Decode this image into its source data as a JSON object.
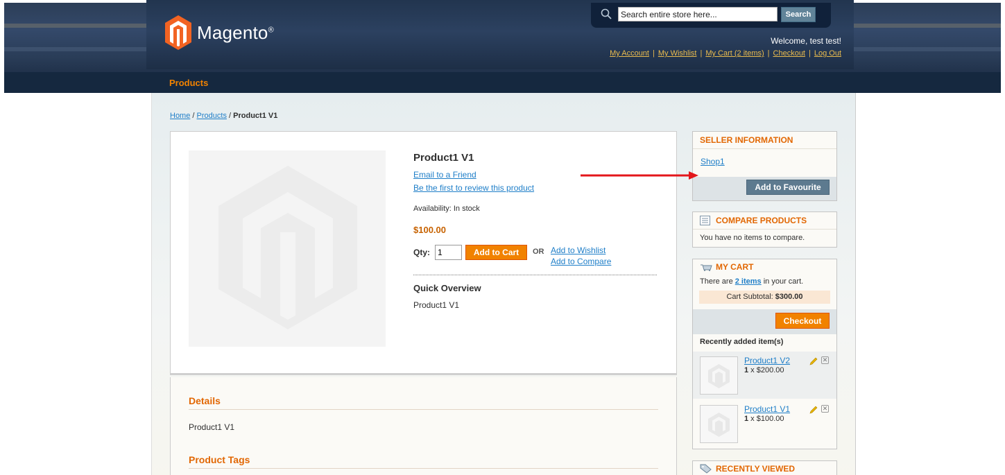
{
  "header": {
    "brand": "Magento",
    "brand_mark": "®",
    "search_placeholder": "Search entire store here...",
    "search_button": "Search",
    "welcome": "Welcome, test test!",
    "links": [
      "My Account",
      "My Wishlist",
      "My Cart (2 items)",
      "Checkout",
      "Log Out"
    ]
  },
  "nav": {
    "products": "Products"
  },
  "breadcrumb": {
    "home": "Home",
    "products": "Products",
    "current": "Product1 V1",
    "sep": "/"
  },
  "product": {
    "name": "Product1 V1",
    "email_friend": "Email to a Friend",
    "review": "Be the first to review this product",
    "availability": "Availability: In stock",
    "price": "$100.00",
    "qty_label": "Qty:",
    "qty_value": "1",
    "add_to_cart": "Add to Cart",
    "or": "OR",
    "add_wishlist": "Add to Wishlist",
    "add_compare": "Add to Compare",
    "quick_overview_title": "Quick Overview",
    "quick_overview_text": "Product1 V1"
  },
  "details": {
    "title": "Details",
    "text": "Product1 V1",
    "tags_title": "Product Tags"
  },
  "sidebar": {
    "seller": {
      "title": "SELLER INFORMATION",
      "shop": "Shop1",
      "button": "Add to Favourite"
    },
    "compare": {
      "title": "COMPARE PRODUCTS",
      "text": "You have no items to compare."
    },
    "cart": {
      "title": "MY CART",
      "text_pre": "There are ",
      "items_link": "2 items",
      "text_post": " in your cart.",
      "subtotal_label": "Cart Subtotal: ",
      "subtotal_value": "$300.00",
      "checkout": "Checkout",
      "recent_label": "Recently added item(s)",
      "items": [
        {
          "name": "Product1 V2",
          "qty": "1",
          "price": " x $200.00"
        },
        {
          "name": "Product1 V1",
          "qty": "1",
          "price": " x $100.00"
        }
      ]
    },
    "recently_viewed": {
      "title": "RECENTLY VIEWED"
    }
  },
  "colors": {
    "accent_orange": "#f18200",
    "link_blue": "#1e7ec8",
    "header_navy": "#15283f"
  }
}
